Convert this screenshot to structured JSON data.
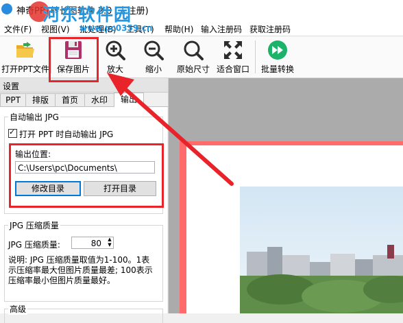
{
  "window": {
    "title": "神奇PPT转长图软件 2.0 (未注册)"
  },
  "watermark": {
    "text": "河东软件园",
    "url": "www.pc0359.cn"
  },
  "menu": {
    "items": [
      {
        "label": "文件(F)"
      },
      {
        "label": "视图(V)"
      },
      {
        "label": "批处理(B)"
      },
      {
        "label": "工具(T)"
      },
      {
        "label": "帮助(H)"
      },
      {
        "label": "输入注册码"
      },
      {
        "label": "获取注册码"
      }
    ]
  },
  "toolbar": {
    "open_ppt": "打开PPT文件",
    "save_image": "保存图片",
    "zoom_in": "放大",
    "zoom_out": "缩小",
    "original_size": "原始尺寸",
    "fit_window": "适合窗口",
    "batch_convert": "批量转换"
  },
  "settings": {
    "title": "设置",
    "tabs": [
      {
        "label": "PPT"
      },
      {
        "label": "排版"
      },
      {
        "label": "首页"
      },
      {
        "label": "水印"
      },
      {
        "label": "输出"
      }
    ],
    "auto_output": {
      "group_label": "自动输出 JPG",
      "checkbox_label": "打开 PPT 时自动输出 JPG",
      "checked": true,
      "output_location_label": "输出位置:",
      "output_path": "C:\\Users\\pc\\Documents\\",
      "change_dir_button": "修改目录",
      "open_dir_button": "打开目录"
    },
    "jpg_quality": {
      "group_label": "JPG 压缩质量",
      "field_label": "JPG 压缩质量:",
      "value": "80",
      "note": "说明: JPG 压缩质量取值为1-100。1表示压缩率最大但图片质量最差; 100表示压缩率最小但图片质量最好。"
    },
    "advanced": {
      "group_label": "高级"
    }
  },
  "colors": {
    "highlight_red": "#e8232a",
    "slide_border": "#ff6a6a",
    "accent_blue": "#2496df",
    "batch_green": "#1bb36a"
  }
}
